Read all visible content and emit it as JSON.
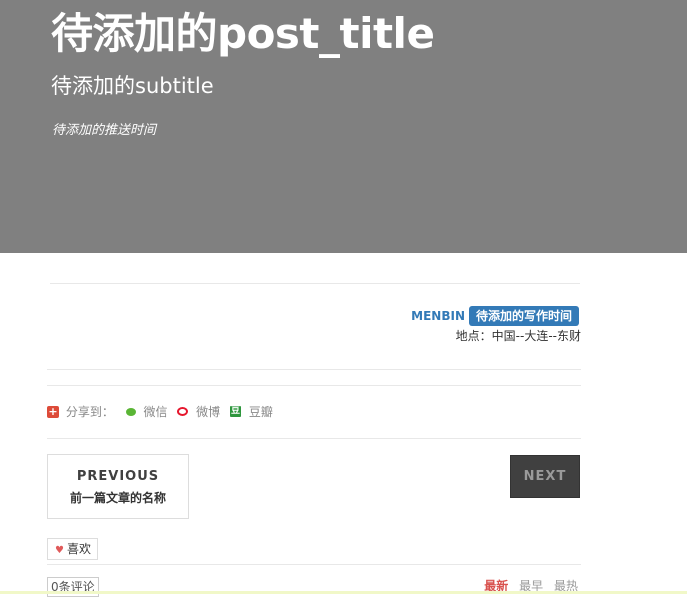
{
  "header": {
    "post_title": "待添加的post_title",
    "subtitle": "待添加的subtitle",
    "push_time": "待添加的推送时间"
  },
  "meta": {
    "author": "MENBIN",
    "write_time": "待添加的写作时间",
    "location": "地点：中国--大连--东财"
  },
  "share": {
    "label": "分享到：",
    "items": [
      {
        "label": "微信",
        "icon": "wechat-icon"
      },
      {
        "label": "微博",
        "icon": "weibo-icon"
      },
      {
        "label": "豆瓣",
        "icon": "douban-icon"
      }
    ]
  },
  "pager": {
    "previous_label": "PREVIOUS",
    "previous_title": "前一篇文章的名称",
    "next_label": "NEXT"
  },
  "like": {
    "label": "喜欢"
  },
  "comments": {
    "count_label": "0条评论",
    "sort_tabs": [
      "最新",
      "最早",
      "最热"
    ],
    "active_tab": "最新"
  },
  "colors": {
    "header_bg": "#808080",
    "accent": "#337ab7",
    "active_tab": "#d9534f"
  }
}
